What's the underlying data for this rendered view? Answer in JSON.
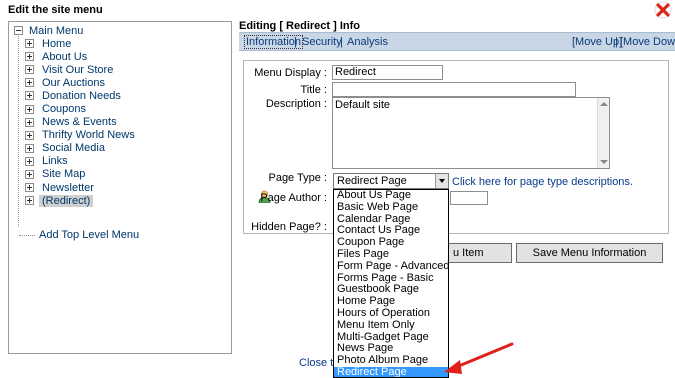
{
  "dialog": {
    "title": "Edit the site menu",
    "close_icon": "close-x-icon"
  },
  "tree": {
    "root_label": "Main Menu",
    "items": [
      {
        "label": "Home"
      },
      {
        "label": "About Us"
      },
      {
        "label": "Visit Our Store"
      },
      {
        "label": "Our Auctions"
      },
      {
        "label": "Donation Needs"
      },
      {
        "label": "Coupons"
      },
      {
        "label": "News & Events"
      },
      {
        "label": "Thrifty World News"
      },
      {
        "label": "Social Media"
      },
      {
        "label": "Links"
      },
      {
        "label": "Site Map"
      },
      {
        "label": "Newsletter"
      },
      {
        "label": "(Redirect)",
        "selected": true
      }
    ],
    "add_top_level": "Add Top Level Menu"
  },
  "editor": {
    "title": "Editing [ Redirect ] Info",
    "tabs": {
      "information": "Information",
      "security": "Security",
      "analysis": "Analysis",
      "separator": "|",
      "move_up": "[Move Up]",
      "move_down": "[Move Down]"
    },
    "fields": {
      "menu_display_label": "Menu Display :",
      "menu_display_value": "Redirect",
      "title_label": "Title :",
      "title_value": "",
      "description_label": "Description :",
      "description_value": "Default site",
      "page_type_label": "Page Type :",
      "page_type_value": "Redirect Page",
      "page_type_help": "Click here for page type descriptions.",
      "page_author_label": "Page Author :",
      "hidden_page_label": "Hidden Page? :"
    },
    "buttons": {
      "menu_item_partial": "u Item",
      "save": "Save Menu Information"
    },
    "page_type_options": [
      "About Us Page",
      "Basic Web Page",
      "Calendar Page",
      "Contact Us Page",
      "Coupon Page",
      "Files Page",
      "Form Page - Advanced",
      "Forms Page - Basic",
      "Guestbook Page",
      "Home Page",
      "Hours of Operation",
      "Menu Item Only",
      "Multi-Gadget Page",
      "News Page",
      "Photo Album Page",
      "Redirect Page"
    ],
    "highlighted_option": "Redirect Page",
    "close_link_partial": "Close th"
  },
  "colors": {
    "accent_red": "#e0201a",
    "tab_bar": "#c8d6e6",
    "link": "#0a3a8a",
    "highlight": "#3399ff"
  }
}
